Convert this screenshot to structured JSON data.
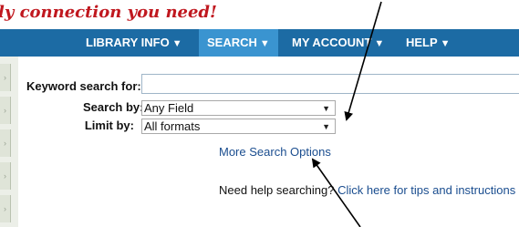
{
  "header": {
    "tagline": "ly connection you need!"
  },
  "nav": {
    "items": [
      {
        "label": "LIBRARY INFO",
        "caret": "▼"
      },
      {
        "label": "SEARCH",
        "caret": "▼"
      },
      {
        "label": "MY ACCOUNT",
        "caret": "▼"
      },
      {
        "label": "HELP",
        "caret": "▼"
      }
    ],
    "active_index": 1,
    "bar_color": "#1c6ba4",
    "active_color": "#3a94d0"
  },
  "form": {
    "keyword_label": "Keyword search for:",
    "keyword_value": "",
    "search_by_label": "Search by:",
    "search_by_value": "Any Field",
    "limit_by_label": "Limit by:",
    "limit_by_value": "All formats"
  },
  "links": {
    "more_options": "More Search Options",
    "help_prefix": "Need help searching?",
    "help_link": "Click here for tips and instructions"
  },
  "icons": {
    "dropdown": "chevron-down-icon",
    "sidebar_tab": "chevron-right-icon"
  }
}
